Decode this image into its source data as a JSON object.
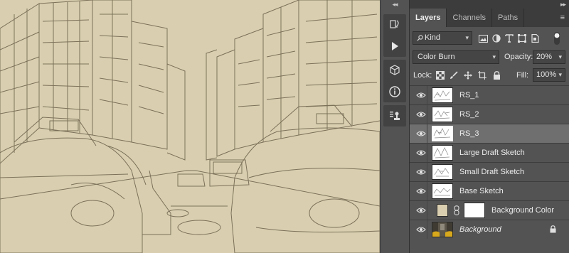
{
  "panel": {
    "tabs": [
      {
        "label": "Layers",
        "active": true
      },
      {
        "label": "Channels",
        "active": false
      },
      {
        "label": "Paths",
        "active": false
      }
    ],
    "filter": {
      "value": "Kind"
    },
    "blend_mode": {
      "value": "Color Burn"
    },
    "opacity": {
      "label": "Opacity:",
      "value": "20%"
    },
    "lock": {
      "label": "Lock:"
    },
    "fill": {
      "label": "Fill:",
      "value": "100%"
    },
    "layers": [
      {
        "name": "RS_1",
        "visible": true,
        "selected": false
      },
      {
        "name": "RS_2",
        "visible": true,
        "selected": false
      },
      {
        "name": "RS_3",
        "visible": true,
        "selected": true
      },
      {
        "name": "Large Draft Sketch",
        "visible": true,
        "selected": false
      },
      {
        "name": "Small Draft Sketch",
        "visible": true,
        "selected": false
      },
      {
        "name": "Base Sketch",
        "visible": true,
        "selected": false
      },
      {
        "name": "Background Color",
        "visible": true,
        "selected": false,
        "swatch_color": "#d9cfb0"
      },
      {
        "name": "Background",
        "visible": true,
        "selected": false,
        "locked": true
      }
    ]
  },
  "colors": {
    "panel_bg": "#535353",
    "canvas_bg": "#d9cfb0",
    "sketch_line": "#6b604a",
    "selected_row": "#6f6f6f"
  }
}
